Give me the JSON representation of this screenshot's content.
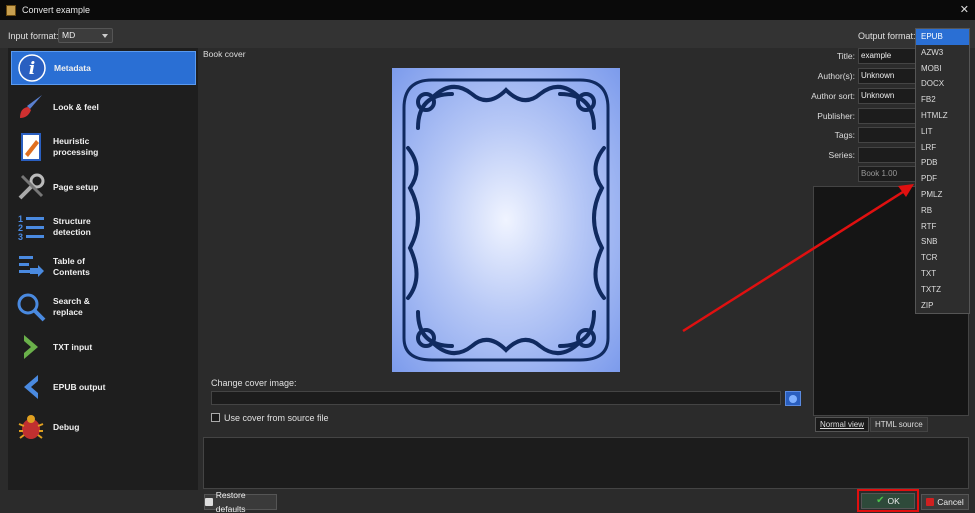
{
  "window": {
    "title": "Convert example",
    "close_glyph": "✕"
  },
  "input_format": {
    "label": "Input format:",
    "value": "MD"
  },
  "output_format": {
    "label": "Output format:",
    "selected": "EPUB",
    "options": [
      "EPUB",
      "AZW3",
      "MOBI",
      "DOCX",
      "FB2",
      "HTMLZ",
      "LIT",
      "LRF",
      "PDB",
      "PDF",
      "PMLZ",
      "RB",
      "RTF",
      "SNB",
      "TCR",
      "TXT",
      "TXTZ",
      "ZIP"
    ]
  },
  "sidebar": {
    "items": [
      {
        "label": "Metadata",
        "icon": "info-icon"
      },
      {
        "label": "Look & feel",
        "icon": "brush-icon"
      },
      {
        "label": "Heuristic processing",
        "icon": "document-edit-icon"
      },
      {
        "label": "Page setup",
        "icon": "tools-icon"
      },
      {
        "label": "Structure detection",
        "icon": "numbered-list-icon"
      },
      {
        "label": "Table of Contents",
        "icon": "toc-icon"
      },
      {
        "label": "Search & replace",
        "icon": "magnifier-icon"
      },
      {
        "label": "TXT input",
        "icon": "chevron-right-icon"
      },
      {
        "label": "EPUB output",
        "icon": "chevron-left-icon"
      },
      {
        "label": "Debug",
        "icon": "bug-icon"
      }
    ]
  },
  "main": {
    "book_cover_label": "Book cover",
    "change_cover_label": "Change cover image:",
    "use_cover_label": "Use cover from source file"
  },
  "metadata": {
    "title_label": "Title:",
    "title_value": "example",
    "authors_label": "Author(s):",
    "authors_value": "Unknown",
    "author_sort_label": "Author sort:",
    "author_sort_value": "Unknown",
    "publisher_label": "Publisher:",
    "tags_label": "Tags:",
    "series_label": "Series:",
    "series_index": "Book 1.00"
  },
  "tabs": {
    "normal": "Normal view",
    "html": "HTML source"
  },
  "buttons": {
    "restore": "Restore defaults",
    "ok": "OK",
    "cancel": "Cancel"
  },
  "colors": {
    "accent": "#2a6fd4",
    "annotation": "#e01010"
  }
}
